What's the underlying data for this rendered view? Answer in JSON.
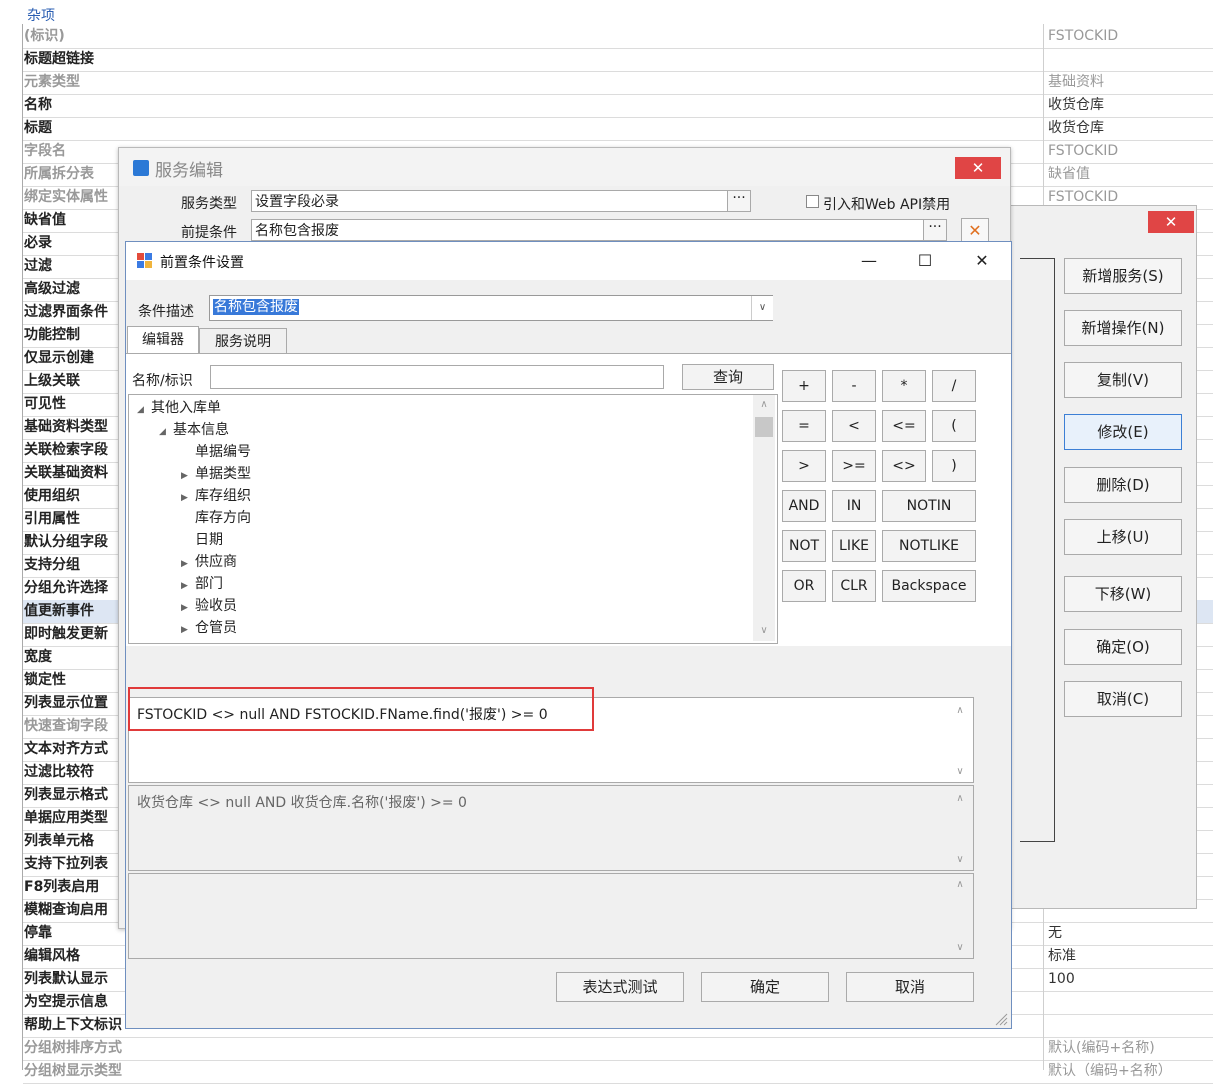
{
  "property_grid": {
    "group_title": "杂项",
    "rows": [
      {
        "name": "(标识)",
        "value": "FSTOCKID",
        "gray": true
      },
      {
        "name": "标题超链接",
        "value": "",
        "gray": false
      },
      {
        "name": "元素类型",
        "value": "基础资料",
        "gray": true
      },
      {
        "name": "名称",
        "value": "收货仓库",
        "gray": false
      },
      {
        "name": "标题",
        "value": "收货仓库",
        "gray": false
      },
      {
        "name": "字段名",
        "value": "FSTOCKID",
        "gray": true
      },
      {
        "name": "所属拆分表",
        "value": "缺省值",
        "gray": true
      },
      {
        "name": "绑定实体属性",
        "value": "FSTOCKID",
        "gray": true
      },
      {
        "name": "缺省值",
        "value": "",
        "gray": false
      },
      {
        "name": "必录",
        "value": "",
        "gray": false
      },
      {
        "name": "过滤",
        "value": "",
        "gray": false
      },
      {
        "name": "高级过滤",
        "value": "",
        "gray": false
      },
      {
        "name": "过滤界面条件",
        "value": "",
        "gray": false
      },
      {
        "name": "功能控制",
        "value": "",
        "gray": false
      },
      {
        "name": "仅显示创建",
        "value": "",
        "gray": false
      },
      {
        "name": "上级关联",
        "value": "",
        "gray": false
      },
      {
        "name": "可见性",
        "value": "",
        "gray": false
      },
      {
        "name": "基础资料类型",
        "value": "",
        "gray": false
      },
      {
        "name": "关联检索字段",
        "value": "",
        "gray": false
      },
      {
        "name": "关联基础资料",
        "value": "",
        "gray": false
      },
      {
        "name": "使用组织",
        "value": "",
        "gray": false
      },
      {
        "name": "引用属性",
        "value": "",
        "gray": false
      },
      {
        "name": "默认分组字段",
        "value": "",
        "gray": false
      },
      {
        "name": "支持分组",
        "value": "",
        "gray": false
      },
      {
        "name": "分组允许选择",
        "value": "",
        "gray": false
      },
      {
        "name": "值更新事件",
        "value": "",
        "gray": false,
        "selected": true
      },
      {
        "name": "即时触发更新",
        "value": "",
        "gray": false
      },
      {
        "name": "宽度",
        "value": "",
        "gray": false
      },
      {
        "name": "锁定性",
        "value": "",
        "gray": false
      },
      {
        "name": "列表显示位置",
        "value": "",
        "gray": false
      },
      {
        "name": "快速查询字段",
        "value": "",
        "gray": true
      },
      {
        "name": "文本对齐方式",
        "value": "",
        "gray": false
      },
      {
        "name": "过滤比较符",
        "value": "",
        "gray": false
      },
      {
        "name": "列表显示格式",
        "value": "",
        "gray": false
      },
      {
        "name": "单据应用类型",
        "value": "",
        "gray": false
      },
      {
        "name": "列表单元格",
        "value": "",
        "gray": false
      },
      {
        "name": "支持下拉列表",
        "value": "",
        "gray": false
      },
      {
        "name": "F8列表启用",
        "value": "",
        "gray": false
      },
      {
        "name": "模糊查询启用",
        "value": "",
        "gray": false
      },
      {
        "name": "停靠",
        "value": "无",
        "gray": false
      },
      {
        "name": "编辑风格",
        "value": "标准",
        "gray": false
      },
      {
        "name": "列表默认显示",
        "value": "100",
        "gray": false
      },
      {
        "name": "为空提示信息",
        "value": "",
        "gray": false
      },
      {
        "name": "帮助上下文标识",
        "value": "",
        "gray": false
      },
      {
        "name": "分组树排序方式",
        "value": "默认(编码+名称)",
        "gray": true
      },
      {
        "name": "分组树显示类型",
        "value": "默认（编码+名称）",
        "gray": true
      }
    ]
  },
  "service_dialog": {
    "title": "服务编辑",
    "service_type_label": "服务类型",
    "service_type_value": "设置字段必录",
    "precondition_label": "前提条件",
    "precondition_value": "名称包含报废",
    "web_api_checkbox_label": "引入和Web API禁用",
    "ellipsis": "···",
    "close_glyph": "✕"
  },
  "action_panel": {
    "close_glyph": "✕",
    "buttons": [
      "新增服务(S)",
      "新增操作(N)",
      "复制(V)",
      "修改(E)",
      "删除(D)",
      "上移(U)",
      "下移(W)",
      "确定(O)",
      "取消(C)"
    ]
  },
  "precondition_dialog": {
    "title": "前置条件设置",
    "min_glyph": "—",
    "max_glyph": "☐",
    "close_glyph": "✕",
    "condition_desc_label": "条件描述",
    "condition_desc_value": "名称包含报废",
    "tabs": [
      "编辑器",
      "服务说明"
    ],
    "search_label": "名称/标识",
    "search_value": "",
    "query_button": "查询",
    "tree": [
      {
        "label": "其他入库单",
        "level": 0,
        "expander": "◢"
      },
      {
        "label": "基本信息",
        "level": 1,
        "expander": "◢"
      },
      {
        "label": "单据编号",
        "level": 2,
        "expander": ""
      },
      {
        "label": "单据类型",
        "level": 2,
        "expander": "▶"
      },
      {
        "label": "库存组织",
        "level": 2,
        "expander": "▶"
      },
      {
        "label": "库存方向",
        "level": 2,
        "expander": ""
      },
      {
        "label": "日期",
        "level": 2,
        "expander": ""
      },
      {
        "label": "供应商",
        "level": 2,
        "expander": "▶"
      },
      {
        "label": "部门",
        "level": 2,
        "expander": "▶"
      },
      {
        "label": "验收员",
        "level": 2,
        "expander": "▶"
      },
      {
        "label": "仓管员",
        "level": 2,
        "expander": "▶"
      }
    ],
    "operators": [
      [
        "+",
        "-",
        "*",
        "/"
      ],
      [
        "=",
        "<",
        "<=",
        "("
      ],
      [
        ">",
        ">=",
        "<>",
        ")"
      ],
      [
        "AND",
        "IN",
        "NOTIN"
      ],
      [
        "NOT",
        "LIKE",
        "NOTLIKE"
      ],
      [
        "OR",
        "CLR",
        "Backspace"
      ]
    ],
    "expression": "FSTOCKID  <> null  AND  FSTOCKID.FName.find('报废') >= 0",
    "expression_display": "收货仓库  <> null  AND  收货仓库.名称('报废') >= 0",
    "test_button": "表达式测试",
    "ok_button": "确定",
    "cancel_button": "取消",
    "highlight_color": "#e03a3a"
  }
}
